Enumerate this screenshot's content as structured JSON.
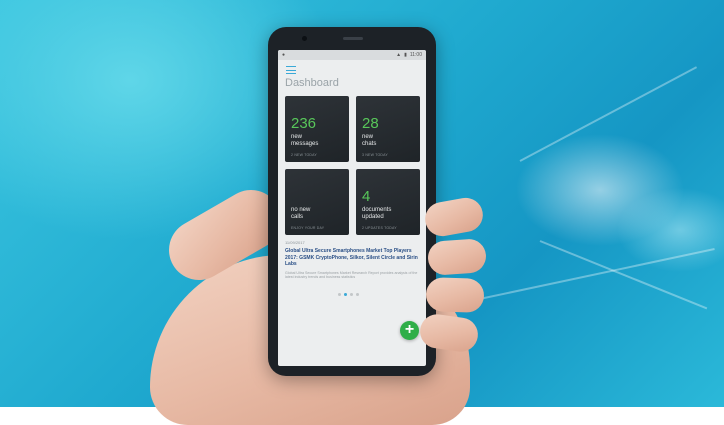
{
  "status_bar": {
    "time": "11:00",
    "signal_icon": "signal-icon",
    "wifi_icon": "wifi-icon",
    "battery_icon": "battery-icon"
  },
  "header": {
    "menu_icon": "hamburger-menu-icon",
    "title": "Dashboard"
  },
  "cards": [
    {
      "value": "236",
      "label_line1": "new",
      "label_line2": "messages",
      "sub": "2 NEW TODAY"
    },
    {
      "value": "28",
      "label_line1": "new",
      "label_line2": "chats",
      "sub": "3 NEW TODAY"
    },
    {
      "value": "",
      "label_line1": "no new",
      "label_line2": "calls",
      "sub": "ENJOY YOUR DAY"
    },
    {
      "value": "4",
      "label_line1": "documents",
      "label_line2": "updated",
      "sub": "2 UPDATES TODAY"
    }
  ],
  "news": {
    "date": "11/09/2017",
    "headline": "Global Ultra Secure Smartphones Market Top Players 2017: GSMK CryptoPhone, Silkor, Silent Circle and Sirin Labs",
    "body": "Global Ultra Secure Smartphones Market Research Report provides analysis of the latest industry trends and business statistics"
  },
  "pager": {
    "count": 4,
    "active_index": 1
  },
  "fab": {
    "symbol": "+"
  },
  "colors": {
    "accent_green": "#58c75a",
    "fab_green": "#2fae48",
    "headline_blue": "#2a4f86",
    "menu_blue": "#3aa9d7",
    "card_dark": "#2e3338"
  }
}
